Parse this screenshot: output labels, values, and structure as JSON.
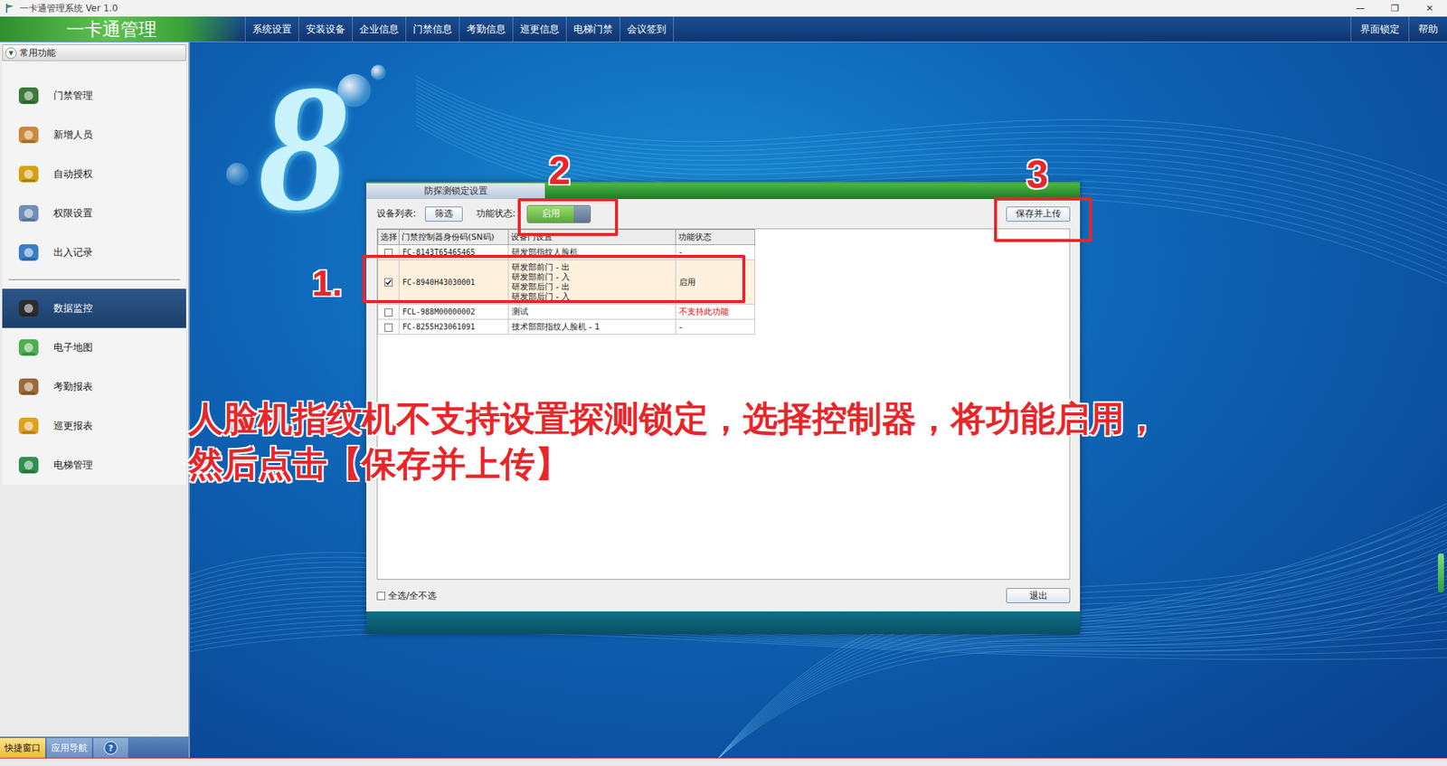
{
  "window": {
    "title": "一卡通管理系统 Ver 1.0",
    "controls": [
      "—",
      "❐",
      "✕"
    ]
  },
  "menubar": {
    "brand": "一卡通管理",
    "items": [
      "系统设置",
      "安装设备",
      "企业信息",
      "门禁信息",
      "考勤信息",
      "巡更信息",
      "电梯门禁",
      "会议签到"
    ],
    "right_items": [
      "界面锁定",
      "帮助"
    ]
  },
  "sidebar": {
    "header": "常用功能",
    "header_icon": "▼",
    "groups": [
      [
        {
          "label": "门禁管理",
          "selected": false
        },
        {
          "label": "新增人员",
          "selected": false
        },
        {
          "label": "自动授权",
          "selected": false
        },
        {
          "label": "权限设置",
          "selected": false
        },
        {
          "label": "出入记录",
          "selected": false
        }
      ],
      [
        {
          "label": "数据监控",
          "selected": true
        },
        {
          "label": "电子地图",
          "selected": false
        },
        {
          "label": "考勤报表",
          "selected": false
        },
        {
          "label": "巡更报表",
          "selected": false
        },
        {
          "label": "电梯管理",
          "selected": false
        }
      ]
    ],
    "bottom_tabs": [
      {
        "label": "快捷窗口",
        "selected": true,
        "kind": "text"
      },
      {
        "label": "应用导航",
        "selected": false,
        "kind": "text"
      },
      {
        "label": "?",
        "selected": false,
        "kind": "icon"
      }
    ]
  },
  "desktop": {
    "logo_glyph": "8"
  },
  "dialog": {
    "title": "防探测锁定设置",
    "device_list_label": "设备列表:",
    "filter_button": "筛选",
    "status_label": "功能状态:",
    "toggle": {
      "label": "启用",
      "on": true
    },
    "save_button": "保存并上传",
    "table": {
      "columns": [
        "选择",
        "门禁控制器身份码(SN码)",
        "设备门设置",
        "功能状态"
      ],
      "rows": [
        {
          "checked": false,
          "sn": "FC-8143T65465465",
          "doors": [
            "研发部指纹人脸机"
          ],
          "status": "-",
          "unsupported": false
        },
        {
          "checked": true,
          "sn": "FC-8940H43030001",
          "doors": [
            "研发部前门 - 出",
            "研发部前门 - 入",
            "研发部后门 - 出",
            "研发部后门 - 入"
          ],
          "status": "启用",
          "unsupported": false
        },
        {
          "checked": false,
          "sn": "FCL-988M00000002",
          "doors": [
            "测试"
          ],
          "status": "不支持此功能",
          "unsupported": true
        },
        {
          "checked": false,
          "sn": "FC-8255H23061091",
          "doors": [
            "技术部部指纹人脸机 - 1"
          ],
          "status": "-",
          "unsupported": false
        }
      ]
    },
    "select_all": {
      "label": "全选/全不选",
      "checked": false
    },
    "exit_button": "退出"
  },
  "annotations": {
    "steps": [
      "1.",
      "2",
      "3"
    ],
    "caption": [
      "人脸机指纹机不支持设置探测锁定，选择控制器，将功能启用，",
      "然后点击【保存并上传】"
    ]
  }
}
